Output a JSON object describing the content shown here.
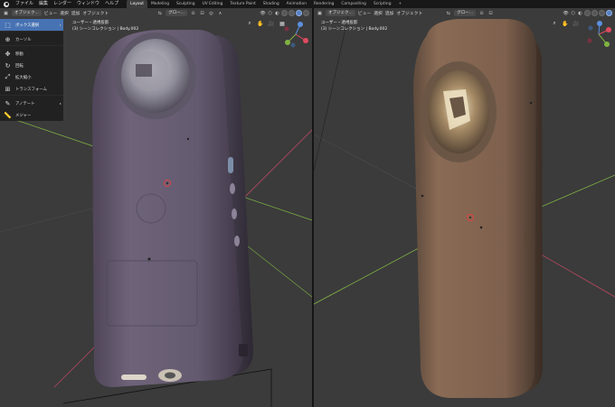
{
  "menubar": {
    "items": [
      "ファイル",
      "編集",
      "レンダー",
      "ウィンドウ",
      "ヘルプ"
    ],
    "workspaces": [
      "Layout",
      "Modeling",
      "Sculpting",
      "UV Editing",
      "Texture Paint",
      "Shading",
      "Animation",
      "Rendering",
      "Compositing",
      "Scripting"
    ],
    "add_tab": "+"
  },
  "left_viewport": {
    "mode_button": "オブジェク...",
    "menus": [
      "ビュー",
      "選択",
      "追加",
      "オブジェクト"
    ],
    "orientation": "グロー...",
    "overlay_line1": "ユーザー・透視投影",
    "overlay_line2": "(3) シーンコレクション | Body.002"
  },
  "right_viewport": {
    "mode_button": "オブジェク...",
    "menus": [
      "ビュー",
      "選択",
      "追加",
      "オブジェクト"
    ],
    "orientation": "グロー...",
    "overlay_line1": "ユーザー・透視投影",
    "overlay_line2": "(3) シーンコレクション | Body.002"
  },
  "toolbar": {
    "tools": [
      {
        "label": "ボックス選択",
        "icon": "box-select-icon",
        "glyph": "⬚",
        "active": true
      },
      {
        "label": "カーソル",
        "icon": "cursor-icon",
        "glyph": "⊕",
        "active": false
      },
      {
        "label": "移動",
        "icon": "move-icon",
        "glyph": "✥",
        "active": false
      },
      {
        "label": "回転",
        "icon": "rotate-icon",
        "glyph": "↻",
        "active": false
      },
      {
        "label": "拡大縮小",
        "icon": "scale-icon",
        "glyph": "⤢",
        "active": false
      },
      {
        "label": "トランスフォーム",
        "icon": "transform-icon",
        "glyph": "⊞",
        "active": false
      },
      {
        "label": "アノテート",
        "icon": "annotate-icon",
        "glyph": "✎",
        "active": false
      },
      {
        "label": "メジャー",
        "icon": "measure-icon",
        "glyph": "📏",
        "active": false
      }
    ]
  },
  "colors": {
    "accent": "#4772b3",
    "viewport_bg": "#3b3b3b",
    "grid_x_axis": "#b5485f",
    "grid_y_axis": "#7fb243",
    "camera_body_left": "#6b5f78",
    "camera_body_right": "#8a6a52"
  }
}
